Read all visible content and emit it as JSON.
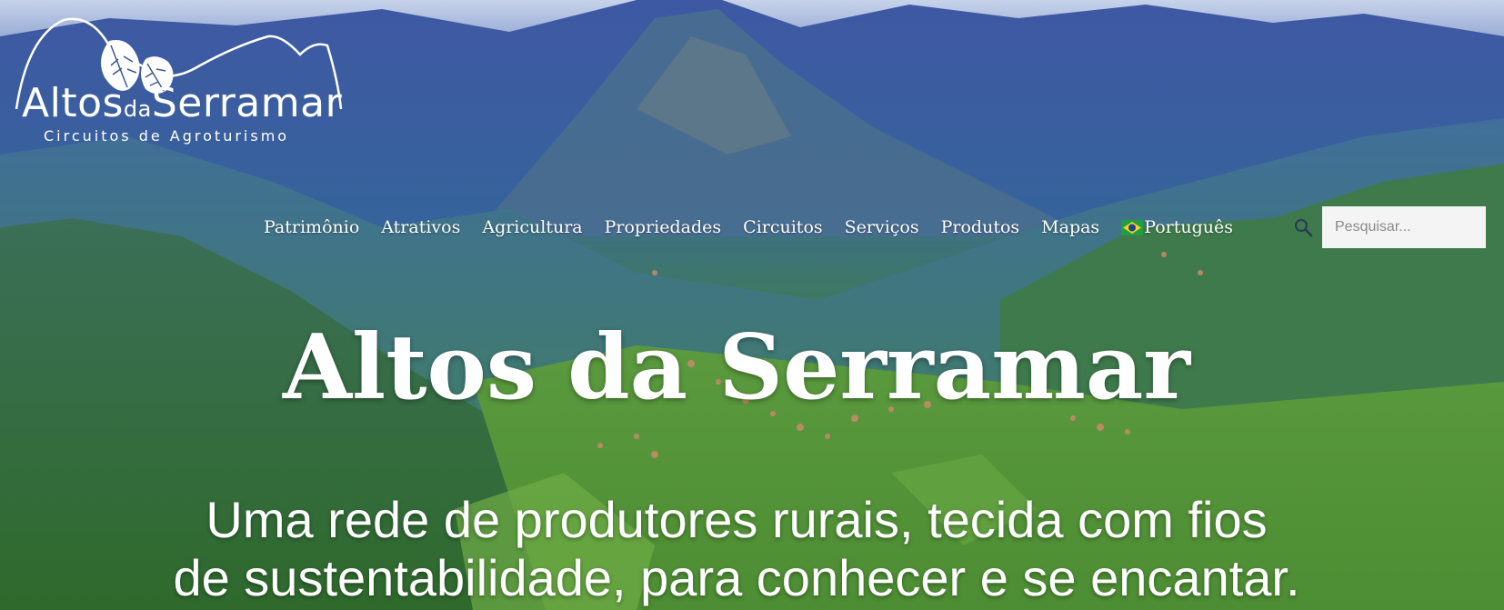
{
  "logo": {
    "name_main_1": "Altos",
    "name_small": "da",
    "name_main_2": "Serramar",
    "tagline": "Circuitos de Agroturismo"
  },
  "nav": {
    "items": [
      {
        "label": "Patrimônio"
      },
      {
        "label": "Atrativos"
      },
      {
        "label": "Agricultura"
      },
      {
        "label": "Propriedades"
      },
      {
        "label": "Circuitos"
      },
      {
        "label": "Serviços"
      },
      {
        "label": "Produtos"
      },
      {
        "label": "Mapas"
      }
    ],
    "language": {
      "label": "Português",
      "flag_icon": "brazil-flag-icon"
    }
  },
  "search": {
    "placeholder": "Pesquisar...",
    "icon": "search-icon"
  },
  "hero": {
    "title": "Altos da Serramar",
    "subtitle_line_1": "Uma rede de produtores rurais, tecida com fios",
    "subtitle_line_2": "de sustentabilidade, para conhecer e se encantar."
  },
  "colors": {
    "text": "#ffffff",
    "search_bg": "#f4f4f4"
  }
}
